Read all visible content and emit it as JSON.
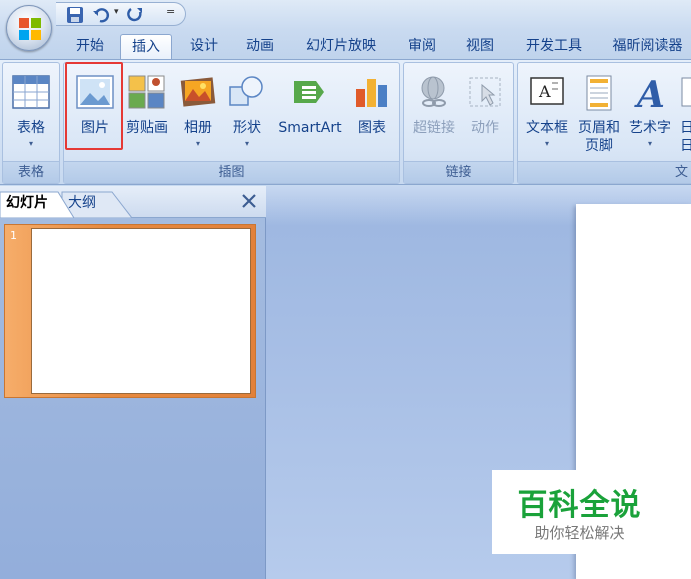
{
  "quick_access": {
    "save_icon": "save-icon",
    "undo_icon": "undo-icon",
    "redo_icon": "redo-icon",
    "dropdown_glyph": "="
  },
  "tabs": [
    {
      "label": "开始",
      "active": false
    },
    {
      "label": "插入",
      "active": true
    },
    {
      "label": "设计",
      "active": false
    },
    {
      "label": "动画",
      "active": false
    },
    {
      "label": "幻灯片放映",
      "active": false
    },
    {
      "label": "审阅",
      "active": false
    },
    {
      "label": "视图",
      "active": false
    },
    {
      "label": "开发工具",
      "active": false
    },
    {
      "label": "福昕阅读器",
      "active": false
    }
  ],
  "ribbon": {
    "groups": {
      "table": {
        "label": "表格",
        "buttons": [
          {
            "label": "表格",
            "icon": "table-icon",
            "has_dropdown": true
          }
        ]
      },
      "illustrations": {
        "label": "插图",
        "buttons": [
          {
            "label": "图片",
            "icon": "picture-icon",
            "has_dropdown": false,
            "highlighted": true
          },
          {
            "label": "剪贴画",
            "icon": "clipart-icon",
            "has_dropdown": false
          },
          {
            "label": "相册",
            "icon": "photo-album-icon",
            "has_dropdown": true
          },
          {
            "label": "形状",
            "icon": "shapes-icon",
            "has_dropdown": true
          },
          {
            "label": "SmartArt",
            "icon": "smartart-icon",
            "has_dropdown": false
          },
          {
            "label": "图表",
            "icon": "chart-icon",
            "has_dropdown": false
          }
        ]
      },
      "links": {
        "label": "链接",
        "buttons": [
          {
            "label": "超链接",
            "icon": "hyperlink-icon",
            "disabled": true
          },
          {
            "label": "动作",
            "icon": "action-icon",
            "disabled": true
          }
        ]
      },
      "text": {
        "label": "文",
        "buttons": [
          {
            "label": "文本框",
            "icon": "textbox-icon",
            "has_dropdown": true
          },
          {
            "label": "页眉和",
            "label2": "页脚",
            "icon": "header-footer-icon"
          },
          {
            "label": "艺术字",
            "icon": "wordart-icon",
            "has_dropdown": true
          },
          {
            "label": "日",
            "label2": "日",
            "icon": "date-time-icon"
          }
        ]
      }
    },
    "dropdown_glyph": "▾"
  },
  "slides_pane": {
    "tabs": [
      {
        "label": "幻灯片",
        "active": true
      },
      {
        "label": "大纲",
        "active": false
      }
    ],
    "close_glyph": "✕",
    "slides": [
      {
        "number": "1"
      }
    ]
  },
  "watermark": {
    "title": "百科全说",
    "subtitle": "助你轻松解决"
  },
  "colors": {
    "accent": "#15428b",
    "ribbon_bg": "#d2e1f4",
    "slide_selected": "#e2813a",
    "highlight_box": "#e53935",
    "watermark_green": "#1aa23a"
  }
}
